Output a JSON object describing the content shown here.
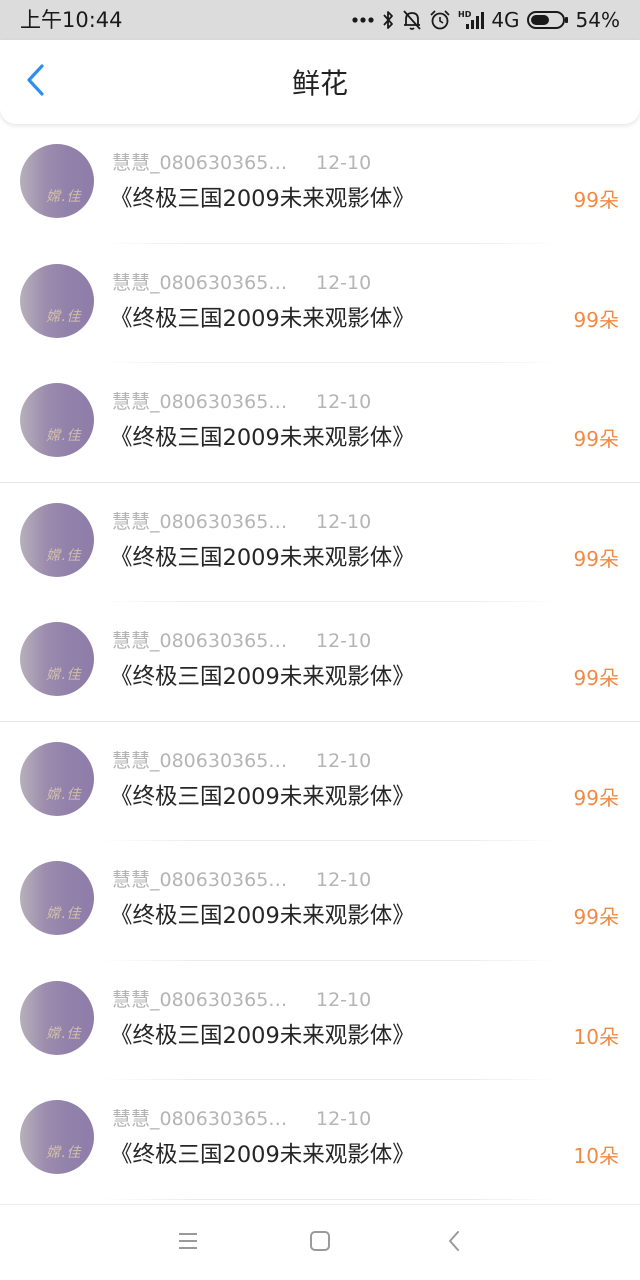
{
  "status_bar": {
    "time": "上午10:44",
    "network": "4G",
    "battery": "54%",
    "icons": [
      "more-dots-icon",
      "bluetooth-icon",
      "mute-bell-icon",
      "alarm-icon",
      "hd-signal-icon",
      "battery-icon"
    ]
  },
  "header": {
    "title": "鲜花",
    "back_icon": "chevron-left-icon",
    "accent_color": "#2f8ff0"
  },
  "list": {
    "amount_color": "#f08a44",
    "items": [
      {
        "username": "慧慧_0806303658...",
        "date": "12-10",
        "movie": "《终极三国2009未来观影体》",
        "amount": "99朵"
      },
      {
        "username": "慧慧_0806303658...",
        "date": "12-10",
        "movie": "《终极三国2009未来观影体》",
        "amount": "99朵"
      },
      {
        "username": "慧慧_0806303658...",
        "date": "12-10",
        "movie": "《终极三国2009未来观影体》",
        "amount": "99朵"
      },
      {
        "username": "慧慧_0806303658...",
        "date": "12-10",
        "movie": "《终极三国2009未来观影体》",
        "amount": "99朵"
      },
      {
        "username": "慧慧_0806303658...",
        "date": "12-10",
        "movie": "《终极三国2009未来观影体》",
        "amount": "99朵"
      },
      {
        "username": "慧慧_0806303658...",
        "date": "12-10",
        "movie": "《终极三国2009未来观影体》",
        "amount": "99朵"
      },
      {
        "username": "慧慧_0806303658...",
        "date": "12-10",
        "movie": "《终极三国2009未来观影体》",
        "amount": "99朵"
      },
      {
        "username": "慧慧_0806303658...",
        "date": "12-10",
        "movie": "《终极三国2009未来观影体》",
        "amount": "10朵"
      },
      {
        "username": "慧慧_0806303658...",
        "date": "12-10",
        "movie": "《终极三国2009未来观影体》",
        "amount": "10朵"
      }
    ]
  },
  "nav_bar": {
    "icons": [
      "menu-icon",
      "home-square-icon",
      "back-triangle-icon"
    ]
  }
}
